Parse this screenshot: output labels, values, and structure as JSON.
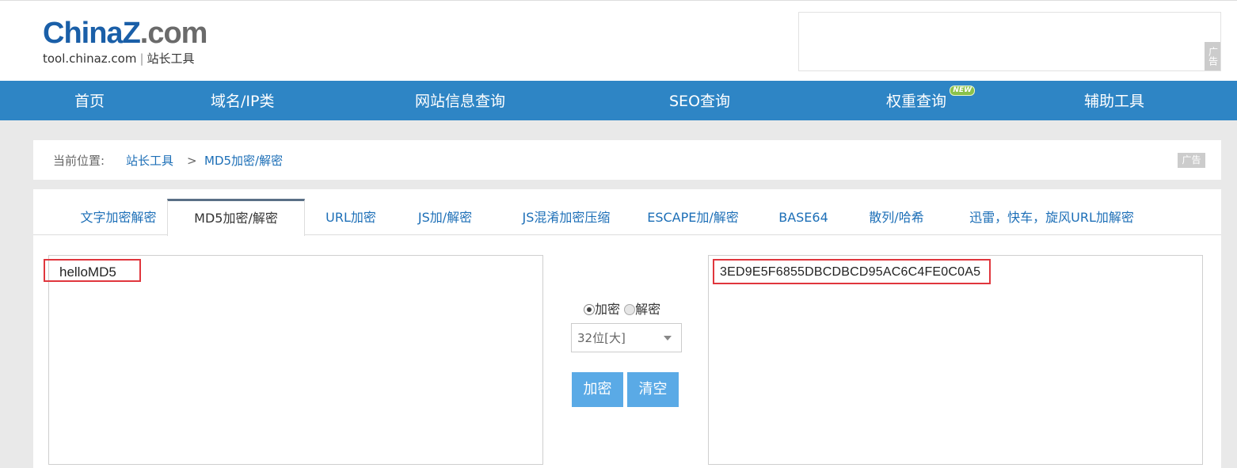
{
  "header": {
    "logo_part1": "China",
    "logo_part2": "Z",
    "logo_part3": ".com",
    "logo_domain": "tool.chinaz.com",
    "logo_separator": "|",
    "logo_tagline": "站长工具",
    "ad_label": "广告"
  },
  "nav": {
    "items": [
      {
        "label": "首页"
      },
      {
        "label": "域名/IP类"
      },
      {
        "label": "网站信息查询"
      },
      {
        "label": "SEO查询"
      },
      {
        "label": "权重查询",
        "badge": "NEW"
      },
      {
        "label": "辅助工具"
      }
    ]
  },
  "breadcrumb": {
    "prefix": "当前位置:",
    "home": "站长工具",
    "separator": ">",
    "current": "MD5加密/解密",
    "ad_label": "广告"
  },
  "tabs": [
    {
      "label": "文字加密解密"
    },
    {
      "label": "MD5加密/解密",
      "active": true
    },
    {
      "label": "URL加密"
    },
    {
      "label": "JS加/解密"
    },
    {
      "label": "JS混淆加密压缩"
    },
    {
      "label": "ESCAPE加/解密"
    },
    {
      "label": "BASE64"
    },
    {
      "label": "散列/哈希"
    },
    {
      "label": "迅雷，快车，旋风URL加解密"
    }
  ],
  "tool": {
    "input_text": "helloMD5",
    "output_text": "3ED9E5F6855DBCDBCD95AC6C4FE0C0A5",
    "radio_encrypt": "加密",
    "radio_decrypt": "解密",
    "mode_selected": "encrypt",
    "length_option": "32位[大]",
    "encrypt_button": "加密",
    "clear_button": "清空"
  },
  "colors": {
    "nav_bg": "#2e85c5",
    "link": "#1d6fb7",
    "button": "#5aaae6",
    "highlight": "#e0363d"
  }
}
